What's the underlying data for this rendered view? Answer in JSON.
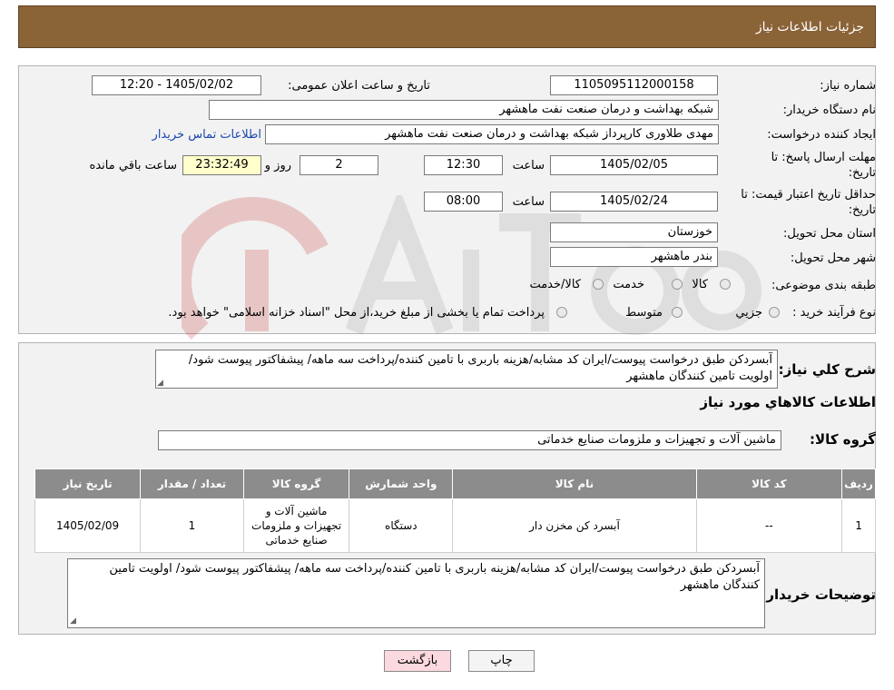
{
  "header": {
    "title": "جزئیات اطلاعات نیاز"
  },
  "form": {
    "need_number_label": "شماره نیاز:",
    "need_number": "1105095112000158",
    "announce_label": "تاریخ و ساعت اعلان عمومی:",
    "announce_value": "1405/02/02 - 12:20",
    "buyer_org_label": "نام دستگاه خریدار:",
    "buyer_org": "شبکه بهداشت و درمان صنعت نفت ماهشهر",
    "requester_label": "ایجاد کننده درخواست:",
    "requester": "مهدی طلاوری کارپرداز شبکه بهداشت و درمان صنعت نفت ماهشهر",
    "contact_link": "اطلاعات تماس خریدار",
    "deadline_label_1": "مهلت ارسال پاسخ: تا",
    "deadline_label_2": "تاریخ:",
    "deadline_date": "1405/02/05",
    "time_label": "ساعت",
    "deadline_time": "12:30",
    "days": "2",
    "days_label": "روز و",
    "remaining": "23:32:49",
    "remaining_label": "ساعت باقي مانده",
    "validity_label_1": "حداقل تاریخ اعتبار قیمت: تا",
    "validity_label_2": "تاریخ:",
    "validity_date": "1405/02/24",
    "validity_time": "08:00",
    "province_label": "استان محل تحویل:",
    "province": "خوزستان",
    "city_label": "شهر محل تحویل:",
    "city": "بندر ماهشهر",
    "category_label": "طبقه بندی موضوعی:",
    "category_options": [
      "کالا",
      "خدمت",
      "کالا/خدمت"
    ],
    "process_label": "نوع فرآیند خرید :",
    "process_options": [
      "جزيي",
      "متوسط"
    ],
    "process_note": "پرداخت تمام یا بخشی از مبلغ خرید،از محل \"اسناد خزانه اسلامی\" خواهد بود."
  },
  "description": {
    "label": "شرح کلي نياز:",
    "text": "آبسردکن طبق درخواست پیوست/ایران کد مشابه/هزینه باربری با تامین کننده/پرداخت سه ماهه/ پیشفاکتور پیوست شود/اولویت تامین کنندگان ماهشهر"
  },
  "goods": {
    "section_title": "اطلاعات کالاهاي مورد نياز",
    "group_label": "گروه کالا:",
    "group_value": "ماشین آلات و تجهیزات و ملزومات صنایع خدماتی"
  },
  "table": {
    "headers": [
      "رديف",
      "کد کالا",
      "نام کالا",
      "واحد شمارش",
      "گروه کالا",
      "تعداد / مقدار",
      "تاریخ نیاز"
    ],
    "rows": [
      [
        "1",
        "--",
        "آبسرد کن مخزن دار",
        "دستگاه",
        "ماشین آلات و تجهیزات و ملزومات صنایع خدماتی",
        "1",
        "1405/02/09"
      ]
    ]
  },
  "buyer_notes": {
    "label": "توضیحات خریدار:",
    "text": "آبسردکن طبق درخواست پیوست/ایران کد مشابه/هزینه باربری با تامین کننده/پرداخت سه ماهه/ پیشفاکتور پیوست شود/ اولویت تامین کنندگان ماهشهر"
  },
  "buttons": {
    "print": "چاپ",
    "back": "بازگشت"
  },
  "colors": {
    "header_bg": "#8a6337",
    "table_header_bg": "#8c8c8c",
    "back_button_bg": "#fbd9de",
    "remaining_bg": "#ffffcc",
    "link": "#1a46b0"
  }
}
